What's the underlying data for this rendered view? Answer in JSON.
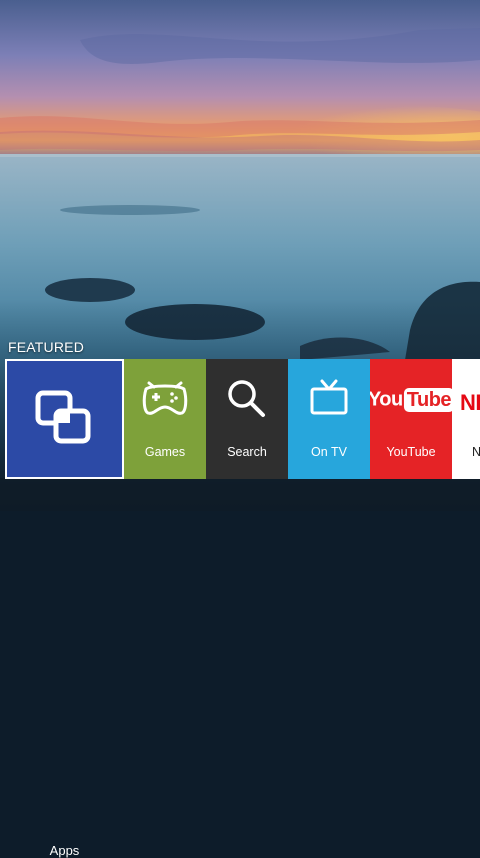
{
  "section": {
    "title": "FEATURED"
  },
  "tiles": [
    {
      "id": "apps",
      "label": "Apps",
      "color": "#2c4aa6",
      "icon": "apps-icon",
      "focused": true
    },
    {
      "id": "games",
      "label": "Games",
      "color": "#7ea13a",
      "icon": "gamepad-icon"
    },
    {
      "id": "search",
      "label": "Search",
      "color": "#2f2f2f",
      "icon": "search-icon"
    },
    {
      "id": "ontv",
      "label": "On TV",
      "color": "#27a6dc",
      "icon": "tv-icon"
    },
    {
      "id": "youtube",
      "label": "YouTube",
      "color": "#e52326",
      "icon": "youtube-logo",
      "logo_you": "You",
      "logo_tube": "Tube"
    },
    {
      "id": "netflix",
      "label": "N",
      "color": "#ffffff",
      "icon": "netflix-logo",
      "logo_text": "NETFLIX"
    }
  ]
}
